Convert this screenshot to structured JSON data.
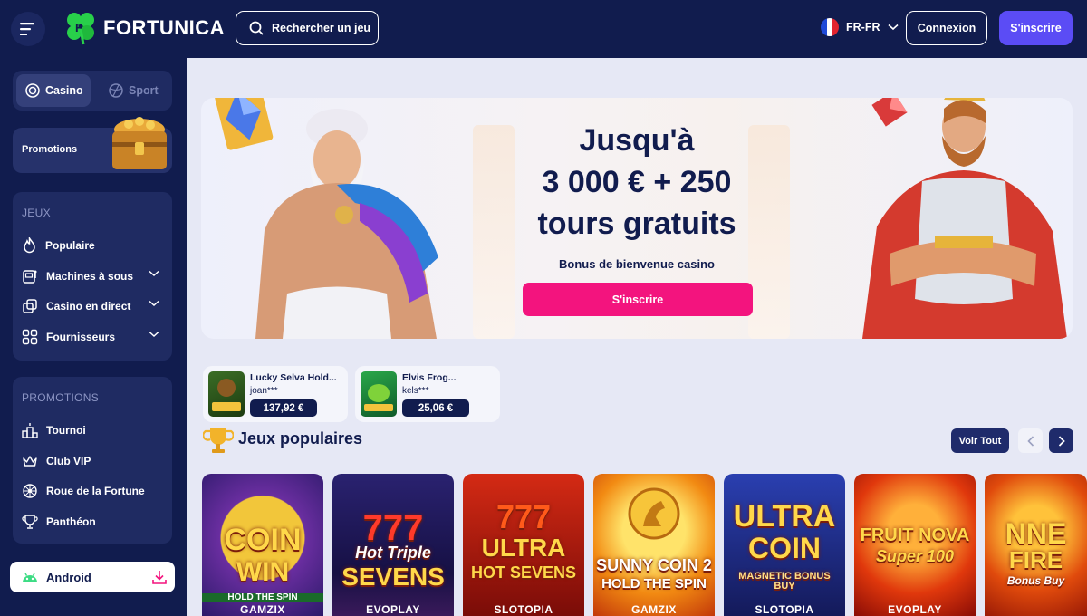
{
  "header": {
    "brand": "FORTUNICA",
    "search_label": "Rechercher un jeu",
    "language": "FR-FR",
    "login_label": "Connexion",
    "signup_label": "S'inscrire"
  },
  "sidebar": {
    "modes": [
      {
        "label": "Casino",
        "active": true
      },
      {
        "label": "Sport",
        "active": false
      }
    ],
    "promo_card_label": "Promotions",
    "games_section": {
      "title": "JEUX",
      "items": [
        {
          "label": "Populaire",
          "icon": "flame-icon",
          "expandable": false
        },
        {
          "label": "Machines à sous",
          "icon": "slot-machine-icon",
          "expandable": true
        },
        {
          "label": "Casino en direct",
          "icon": "live-dealer-icon",
          "expandable": true
        },
        {
          "label": "Fournisseurs",
          "icon": "grid-icon",
          "expandable": true
        }
      ]
    },
    "promotions_section": {
      "title": "PROMOTIONS",
      "items": [
        {
          "label": "Tournoi",
          "icon": "podium-icon"
        },
        {
          "label": "Club VIP",
          "icon": "crown-icon"
        },
        {
          "label": "Roue de la Fortune",
          "icon": "wheel-icon"
        },
        {
          "label": "Panthéon",
          "icon": "trophy-icon"
        }
      ]
    },
    "android_label": "Android"
  },
  "hero": {
    "line1": "Jusqu'à",
    "line2": "3 000 € + 250",
    "line3": "tours gratuits",
    "subtitle": "Bonus de bienvenue casino",
    "cta_label": "S'inscrire"
  },
  "winners": [
    {
      "game": "Lucky Selva Hold...",
      "user": "joan***",
      "amount": "137,92 €",
      "thumb_color": "#2e5a1c"
    },
    {
      "game": "Elvis Frog...",
      "user": "kels***",
      "amount": "25,06 €",
      "thumb_color": "#1b7a3a"
    }
  ],
  "popular": {
    "title": "Jeux populaires",
    "see_all_label": "Voir Tout",
    "games": [
      {
        "title_top": "COIN",
        "title_bottom": "WIN",
        "tagline": "HOLD THE SPIN",
        "provider": "GAMZIX",
        "bg": "#3a2a8a"
      },
      {
        "title_top": "Hot Triple",
        "title_bottom": "SEVENS",
        "tagline": "",
        "provider": "EVOPLAY",
        "bg": "#1c1a5a"
      },
      {
        "title_top": "ULTRA",
        "title_bottom": "HOT SEVENS",
        "tagline": "",
        "provider": "SLOTOPIA",
        "bg": "#b8160e"
      },
      {
        "title_top": "SUNNY COIN 2",
        "title_bottom": "HOLD THE SPIN",
        "tagline": "",
        "provider": "GAMZIX",
        "bg": "#d8490a"
      },
      {
        "title_top": "ULTRA",
        "title_bottom": "COIN",
        "tagline": "MAGNETIC BONUS BUY",
        "provider": "SLOTOPIA",
        "bg": "#1a2a8a"
      },
      {
        "title_top": "FRUIT NOVA",
        "title_bottom": "Super 100",
        "tagline": "",
        "provider": "EVOPLAY",
        "bg": "#c2200c"
      },
      {
        "title_top": "NNE",
        "title_bottom": "FIRE",
        "tagline": "Bonus Buy",
        "provider": "",
        "bg": "#d4380a"
      }
    ]
  }
}
